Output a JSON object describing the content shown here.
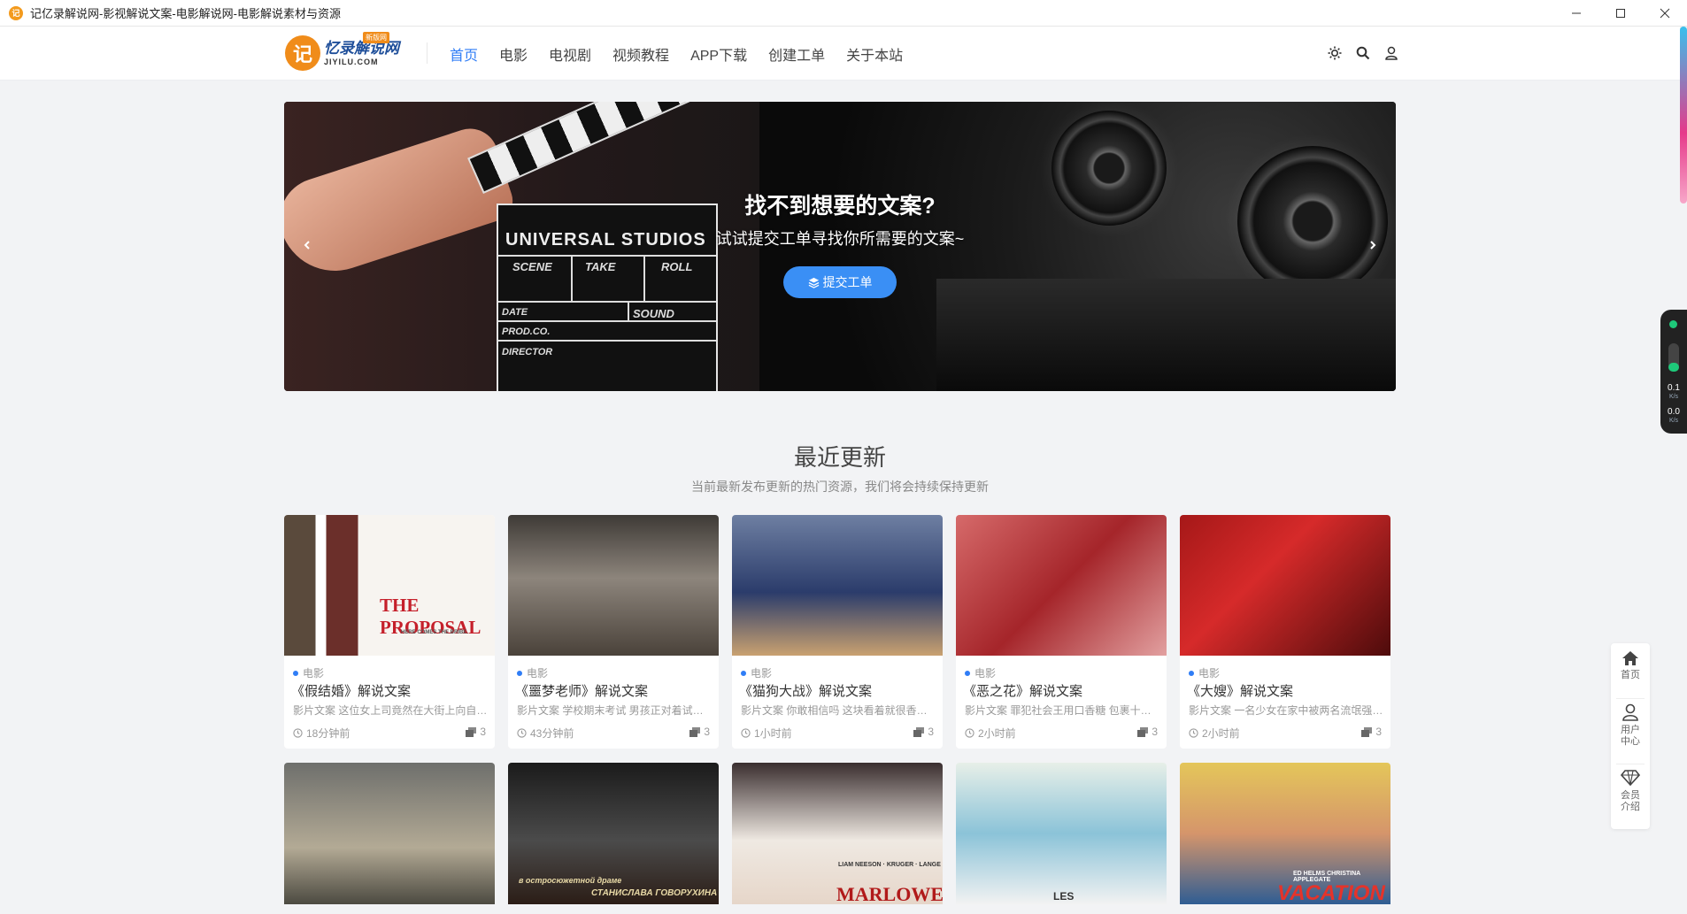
{
  "window": {
    "title": "记亿录解说网-影视解说文案-电影解说网-电影解说素材与资源",
    "app_icon": "记"
  },
  "header": {
    "logo_mark": "记",
    "logo_name": "忆录解说网",
    "logo_domain": "JIYILU.COM",
    "logo_badge": "新版网",
    "nav": [
      {
        "label": "首页",
        "active": true
      },
      {
        "label": "电影"
      },
      {
        "label": "电视剧"
      },
      {
        "label": "视频教程"
      },
      {
        "label": "APP下载"
      },
      {
        "label": "创建工单"
      },
      {
        "label": "关于本站"
      }
    ],
    "icons": [
      "theme-toggle-icon",
      "search-icon",
      "user-icon"
    ]
  },
  "banner": {
    "title": "找不到想要的文案?",
    "subtitle": "试试提交工单寻找你所需要的文案~",
    "button_label": "提交工单",
    "clapper": {
      "brand": "UNIVERSAL STUDIOS",
      "scene": "SCENE",
      "take": "TAKE",
      "roll": "ROLL",
      "date": "DATE",
      "sound": "SOUND",
      "prod": "PROD.CO.",
      "director": "DIRECTOR"
    }
  },
  "section": {
    "title": "最近更新",
    "subtitle": "当前最新发布更新的热门资源，我们将会持续保持更新"
  },
  "cards": [
    {
      "category": "电影",
      "title": "《假结婚》解说文案",
      "desc": "影片文案 这位女上司竟然在大街上向自…",
      "time": "18分钟前",
      "count": "3",
      "poster_text": "THE PROPOSAL",
      "poster_sub": "HERE COMES THE BRIBE."
    },
    {
      "category": "电影",
      "title": "《噩梦老师》解说文案",
      "desc": "影片文案 学校期末考试 男孩正对着试…",
      "time": "43分钟前",
      "count": "3"
    },
    {
      "category": "电影",
      "title": "《猫狗大战》解说文案",
      "desc": "影片文案 你敢相信吗 这块看着就很香…",
      "time": "1小时前",
      "count": "3"
    },
    {
      "category": "电影",
      "title": "《恶之花》解说文案",
      "desc": "影片文案 罪犯社会王用口香糖 包裹十…",
      "time": "2小时前",
      "count": "3"
    },
    {
      "category": "电影",
      "title": "《大嫂》解说文案",
      "desc": "影片文案 一名少女在家中被两名流氓强…",
      "time": "2小时前",
      "count": "3"
    }
  ],
  "cards_row2": [
    {
      "poster_text": ""
    },
    {
      "poster_text": "в остросюжетной драме",
      "poster_sub": "СТАНИСЛАВА ГОВОРУХИНА"
    },
    {
      "poster_text": "MARLOWE",
      "poster_sub": "LIAM NEESON · KRUGER · LANGE"
    },
    {
      "poster_text": "LES"
    },
    {
      "poster_text": "VACATION",
      "poster_sub": "ED HELMS  CHRISTINA APPLEGATE"
    }
  ],
  "side_panel": [
    {
      "label": "首页",
      "icon": "home-icon"
    },
    {
      "label": "用户中心",
      "icon": "user-center-icon"
    },
    {
      "label": "会员介绍",
      "icon": "diamond-icon"
    }
  ],
  "net_widget": {
    "up": "0.1",
    "up_unit": "K/s",
    "down": "0.0",
    "down_unit": "K/s"
  },
  "colors": {
    "accent": "#2f7df6",
    "logo_orange": "#f08c1a",
    "button_blue": "#3a8ff5"
  }
}
